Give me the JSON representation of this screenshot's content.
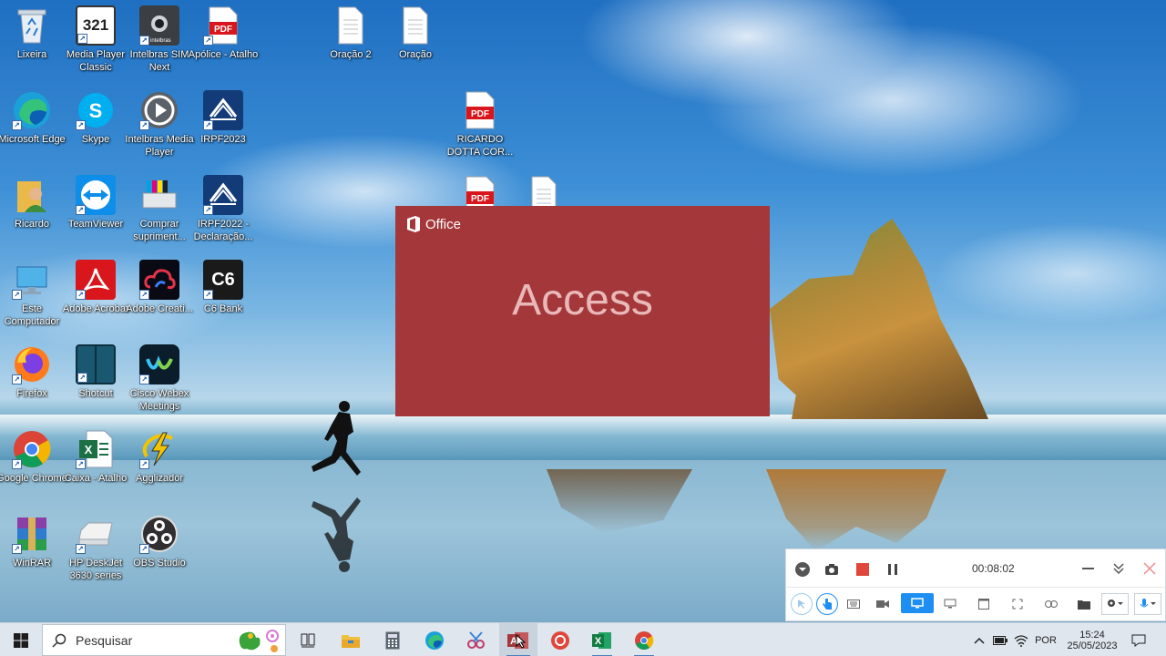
{
  "desktop": {
    "icons": [
      {
        "label": "Lixeira"
      },
      {
        "label": "Media Player Classic"
      },
      {
        "label": "Intelbras SIM Next"
      },
      {
        "label": "Apólice - Atalho"
      },
      {
        "label": "Oração 2"
      },
      {
        "label": "Oração"
      },
      {
        "label": "Microsoft Edge"
      },
      {
        "label": "Skype"
      },
      {
        "label": "Intelbras Media Player"
      },
      {
        "label": "IRPF2023"
      },
      {
        "label": "RICARDO DOTTA COR..."
      },
      {
        "label": "Ricardo"
      },
      {
        "label": "TeamViewer"
      },
      {
        "label": "Comprar supriment..."
      },
      {
        "label": "IRPF2022 - Declaração..."
      },
      {
        "label": "Este Computador"
      },
      {
        "label": "Adobe Acrobat"
      },
      {
        "label": "Adobe Creati..."
      },
      {
        "label": "C6 Bank"
      },
      {
        "label": "Firefox"
      },
      {
        "label": "Shotcut"
      },
      {
        "label": "Cisco Webex Meetings"
      },
      {
        "label": "Google Chrome"
      },
      {
        "label": "Caixa - Atalho"
      },
      {
        "label": "Agglizador"
      },
      {
        "label": "WinRAR"
      },
      {
        "label": "HP DeskJet 3630 series"
      },
      {
        "label": "OBS Studio"
      }
    ],
    "glyphs": {
      "pdf": "PDF",
      "mpc": "321",
      "c6": "C6",
      "intelbras": "intelbras"
    }
  },
  "splash": {
    "brand": "Office",
    "product": "Access",
    "color": "#a4373a"
  },
  "recorder": {
    "timer": "00:08:02"
  },
  "taskbar": {
    "search_placeholder": "Pesquisar",
    "language": "POR",
    "time": "15:24",
    "date": "25/05/2023"
  }
}
